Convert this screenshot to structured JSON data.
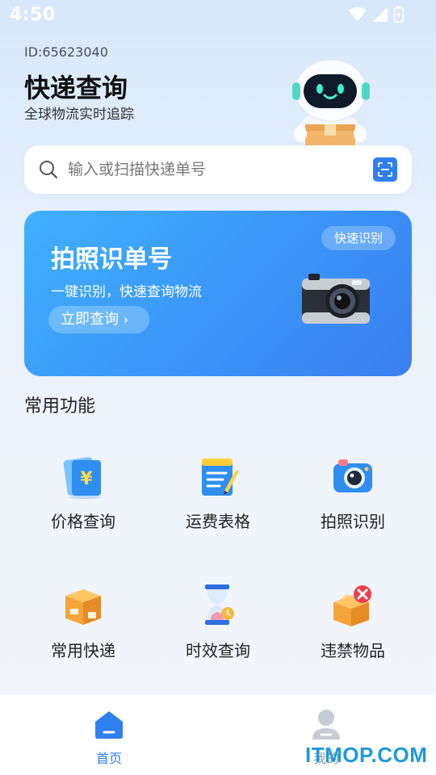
{
  "status_bar": {
    "time": "4:50",
    "icons": [
      "wifi-icon",
      "signal-icon",
      "battery-charging-icon"
    ]
  },
  "header": {
    "user_id": "ID:65623040",
    "title": "快递查询",
    "subtitle": "全球物流实时追踪",
    "mascot": "robot-mascot-icon"
  },
  "search": {
    "placeholder": "输入或扫描快递单号",
    "value": "",
    "scan_icon": "scan-icon"
  },
  "banner": {
    "title": "拍照识单号",
    "description": "一键识别，快速查询物流",
    "button_label": "立即查询",
    "button_chevron": "›",
    "tag": "快速识别",
    "image": "camera-icon"
  },
  "features": {
    "section_title": "常用功能",
    "items": [
      {
        "label": "价格查询",
        "icon": "price-tag-icon"
      },
      {
        "label": "运费表格",
        "icon": "notepad-icon"
      },
      {
        "label": "拍照识别",
        "icon": "camera-icon"
      },
      {
        "label": "常用快递",
        "icon": "package-box-icon"
      },
      {
        "label": "时效查询",
        "icon": "hourglass-icon"
      },
      {
        "label": "违禁物品",
        "icon": "forbidden-box-icon"
      }
    ]
  },
  "bottom_nav": {
    "items": [
      {
        "label": "首页",
        "icon": "home-icon",
        "active": true
      },
      {
        "label": "我的",
        "icon": "user-icon",
        "active": false
      }
    ]
  },
  "watermark": "ITMOP.COM",
  "colors": {
    "accent": "#2f7ff0",
    "banner_start": "#40b0ff",
    "banner_end": "#3a7ef0",
    "watermark": "#1f9ad9"
  }
}
